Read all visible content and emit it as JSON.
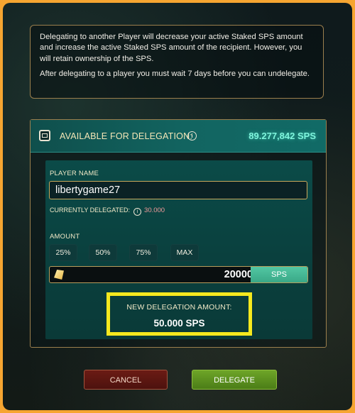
{
  "info": {
    "paragraph1": "Delegating to another Player will decrease your active Staked SPS amount and increase the active Staked SPS amount of the recipient. However, you will retain ownership of the SPS.",
    "paragraph2": "After delegating to a player you must wait 7 days before you can undelegate."
  },
  "header": {
    "label": "AVAILABLE FOR DELEGATION:",
    "info_icon": "i",
    "amount": "89.277,842 SPS"
  },
  "player": {
    "label": "PLAYER NAME",
    "value": "libertygame27",
    "currently_delegated_label": "CURRENTLY DELEGATED:",
    "currently_delegated_value": "30.000"
  },
  "amount": {
    "label": "AMOUNT",
    "quick_buttons": [
      "25%",
      "50%",
      "75%",
      "MAX"
    ],
    "value": "20000",
    "unit": "SPS"
  },
  "new_delegation": {
    "label": "NEW DELEGATION AMOUNT:",
    "value": "50.000 SPS"
  },
  "buttons": {
    "cancel": "CANCEL",
    "delegate": "DELEGATE"
  },
  "colors": {
    "accent_teal": "#7ff5dd",
    "highlight_yellow": "#f5e81e",
    "frame_orange": "#f6a531",
    "delegate_green": "#5e931f",
    "cancel_red": "#5c1711"
  }
}
